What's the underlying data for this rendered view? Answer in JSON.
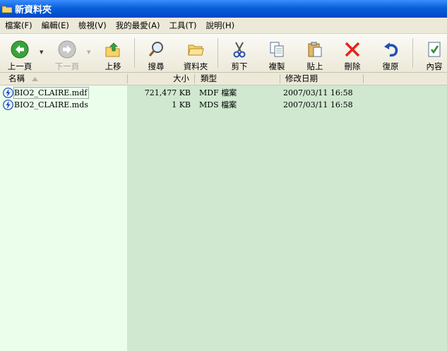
{
  "window": {
    "title": "新資料夾",
    "folder_icon": "folder-icon"
  },
  "menu": [
    "檔案(F)",
    "編輯(E)",
    "檢視(V)",
    "我的最愛(A)",
    "工具(T)",
    "說明(H)"
  ],
  "toolbar": {
    "back": "上一頁",
    "forward": "下一頁",
    "up": "上移",
    "search": "搜尋",
    "folders": "資料夾",
    "cut": "剪下",
    "copy": "複製",
    "paste": "貼上",
    "delete": "刪除",
    "undo": "復原",
    "properties": "內容"
  },
  "columns": {
    "name": "名稱",
    "size": "大小",
    "type": "類型",
    "modified": "修改日期"
  },
  "files": [
    {
      "name": "BIO2_CLAIRE.mdf",
      "size": "721,477 KB",
      "type": "MDF 檔案",
      "modified": "2007/03/11 16:58",
      "selected": true
    },
    {
      "name": "BIO2_CLAIRE.mds",
      "size": "1 KB",
      "type": "MDS 檔案",
      "modified": "2007/03/11 16:58",
      "selected": false
    }
  ],
  "colors": {
    "title_bar": "#0a5fd8",
    "list_background": "#cfe8cf",
    "sorted_column": "#ebfdeb"
  }
}
